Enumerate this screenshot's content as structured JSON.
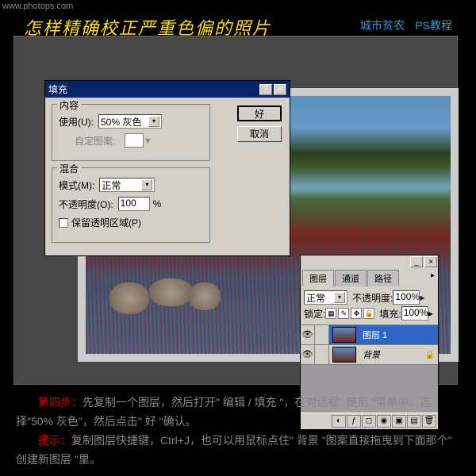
{
  "header": {
    "url": "www.photops.com",
    "title": "怎样精确校正严重色偏的照片",
    "link1": "城市贫农",
    "link2": "PS教程"
  },
  "fill_dialog": {
    "title": "填充",
    "section_content": "内容",
    "use_label": "使用(U):",
    "use_value": "50% 灰色",
    "custom_label": "自定图案:",
    "section_blend": "混合",
    "mode_label": "模式(M):",
    "mode_value": "正常",
    "opacity_label": "不透明度(O):",
    "opacity_value": "100",
    "opacity_unit": "%",
    "preserve_label": "保留透明区域(P)",
    "ok": "好",
    "cancel": "取消"
  },
  "layers_panel": {
    "tabs": [
      "图层",
      "通道",
      "路径"
    ],
    "blend_value": "正常",
    "opacity_label": "不透明度:",
    "opacity_value": "100%",
    "lock_label": "锁定:",
    "fill_label": "填充:",
    "fill_value": "100%",
    "items": [
      {
        "name": "图层 1",
        "selected": true
      },
      {
        "name": "背景",
        "selected": false,
        "locked": true
      }
    ],
    "bottom_icons": [
      "◐",
      "fx",
      "◻",
      "◉",
      "▣",
      "✎",
      "🗑"
    ]
  },
  "description": {
    "step_label": "第四步：",
    "step_text": "先复制一个图层，然后打开\" 编辑 / 填充 \"，在对话框\" 使用 \"菜单中，选择\"50% 灰色\"，然后点击\" 好 \"确认。",
    "tip_label": "提示：",
    "tip_text": "复制图层快捷键，Ctrl+J，也可以用鼠标点住\" 背景 \"图案直接拖曳到下面那个\" 创建新图层 \"里。"
  }
}
